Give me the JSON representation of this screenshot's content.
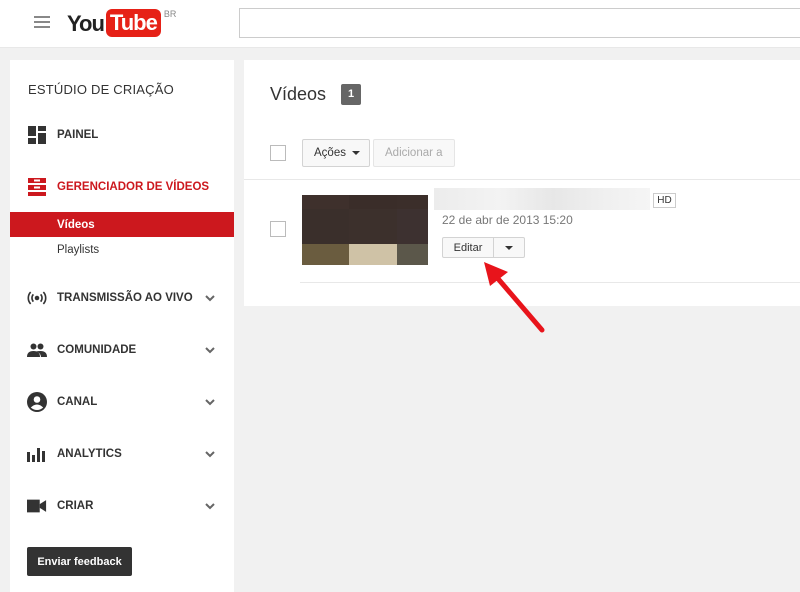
{
  "header": {
    "logo_you": "You",
    "logo_tube": "Tube",
    "country": "BR",
    "search_value": ""
  },
  "sidebar": {
    "title": "ESTÚDIO DE CRIAÇÃO",
    "items": [
      {
        "label": "PAINEL",
        "icon": "dashboard-icon"
      },
      {
        "label": "GERENCIADOR DE VÍDEOS",
        "icon": "video-manager-icon",
        "active": true
      },
      {
        "label": "TRANSMISSÃO AO VIVO",
        "icon": "live-broadcast-icon"
      },
      {
        "label": "COMUNIDADE",
        "icon": "community-icon"
      },
      {
        "label": "CANAL",
        "icon": "channel-icon"
      },
      {
        "label": "ANALYTICS",
        "icon": "analytics-icon"
      },
      {
        "label": "CRIAR",
        "icon": "create-camera-icon"
      }
    ],
    "subitems": [
      {
        "label": "Vídeos",
        "active": true
      },
      {
        "label": "Playlists",
        "active": false
      }
    ],
    "feedback_label": "Enviar feedback"
  },
  "main": {
    "title": "Vídeos",
    "count": "1",
    "actions_label": "Ações",
    "add_to_label": "Adicionar a",
    "video": {
      "hd_label": "HD",
      "date": "22 de abr de 2013 15:20",
      "edit_label": "Editar"
    }
  },
  "colors": {
    "brand_red": "#cc181e",
    "logo_red": "#e62117",
    "annotation_arrow": "#e8141b"
  }
}
